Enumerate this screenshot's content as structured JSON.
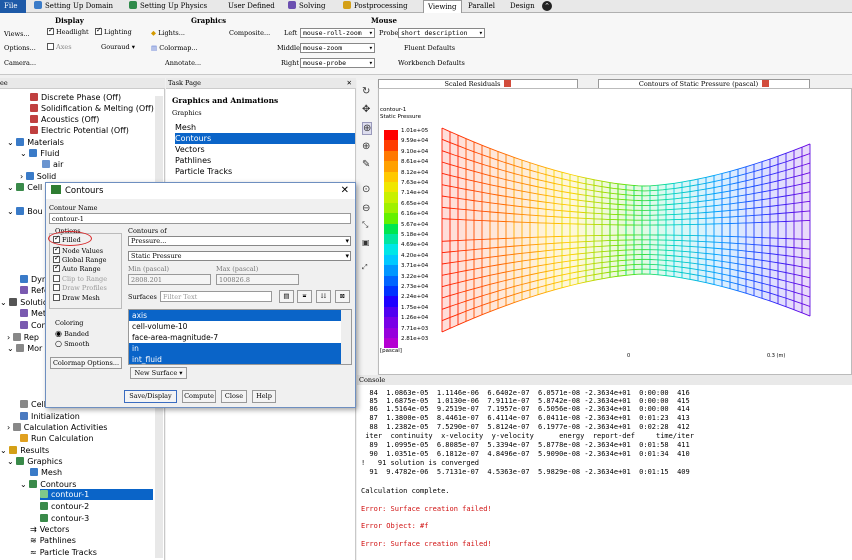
{
  "tabs": [
    "File",
    "Setting Up Domain",
    "Setting Up Physics",
    "User Defined",
    "Solving",
    "Postprocessing",
    "Viewing",
    "Parallel",
    "Design"
  ],
  "ribbon": {
    "display": {
      "heading": "Display",
      "views": "Views...",
      "options": "Options...",
      "camera": "Camera...",
      "headlight": "Headlight",
      "lighting": "Lighting",
      "axes": "Axes",
      "shading": "Gouraud"
    },
    "graphics": {
      "heading": "Graphics",
      "lights": "Lights...",
      "composite": "Composite...",
      "colormap": "Colormap...",
      "annotate": "Annotate..."
    },
    "mouse": {
      "heading": "Mouse",
      "left_label": "Left",
      "left_value": "mouse-roll-zoom",
      "middle_label": "Middle",
      "middle_value": "mouse-zoom",
      "right_label": "Right",
      "right_value": "mouse-probe",
      "probe_label": "Probe",
      "probe_value": "short description",
      "fluent_defaults": "Fluent Defaults",
      "workbench_defaults": "Workbench Defaults"
    }
  },
  "tree": {
    "header": "ee",
    "items": [
      "Discrete Phase (Off)",
      "Solidification & Melting (Off)",
      "Acoustics (Off)",
      "Electric Potential (Off)",
      "Materials",
      "Fluid",
      "air",
      "Solid",
      "Cell",
      "Bou",
      "Dyn",
      "Refe",
      "Solutio",
      "Met",
      "Con",
      "Rep",
      "Mor",
      "Cell",
      "Initialization",
      "Calculation Activities",
      "Run Calculation",
      "Results",
      "Graphics",
      "Mesh",
      "Contours",
      "contour-1",
      "contour-2",
      "contour-3",
      "Vectors",
      "Pathlines",
      "Particle Tracks"
    ]
  },
  "task_page": {
    "header": "Task Page",
    "title": "Graphics and Animations",
    "subtitle": "Graphics",
    "list": [
      "Mesh",
      "Contours",
      "Vectors",
      "Pathlines",
      "Particle Tracks"
    ]
  },
  "graphics_tabs": [
    "Scaled Residuals",
    "Contours of Static Pressure (pascal)"
  ],
  "contour_plot": {
    "name": "contour-1",
    "quantity": "Static Pressure",
    "unit": "[pascal]",
    "levels": [
      "1.01e+05",
      "9.59e+04",
      "9.10e+04",
      "8.61e+04",
      "8.12e+04",
      "7.63e+04",
      "7.14e+04",
      "6.65e+04",
      "6.16e+04",
      "5.67e+04",
      "5.18e+04",
      "4.69e+04",
      "4.20e+04",
      "3.71e+04",
      "3.22e+04",
      "2.73e+04",
      "2.24e+04",
      "1.75e+04",
      "1.26e+04",
      "7.71e+03",
      "2.81e+03"
    ],
    "level_colors": [
      "#ff0000",
      "#ff3c00",
      "#ff7800",
      "#ffa000",
      "#ffc800",
      "#f0e600",
      "#c8f000",
      "#a0f000",
      "#64f000",
      "#00e650",
      "#00e6a0",
      "#00e6e6",
      "#00c8ff",
      "#0096ff",
      "#0064ff",
      "#0032ff",
      "#1e00ff",
      "#5000f0",
      "#7800e6",
      "#9600dc",
      "#b400d2"
    ],
    "scale_label": "0.3 (m)",
    "scale_zero": "0"
  },
  "console": {
    "header": "Console",
    "rows": [
      "  84  1.0863e-05  1.1146e-06  6.6402e-07  6.0571e-08 -2.3634e+01  0:00:00  416",
      "  85  1.6875e-05  1.0130e-06  7.9111e-07  5.8742e-08 -2.3634e+01  0:00:00  415",
      "  86  1.5164e-05  9.2519e-07  7.1957e-07  6.5056e-08 -2.3634e+01  0:00:00  414",
      "  87  1.3800e-05  8.4461e-07  6.4114e-07  6.0411e-08 -2.3634e+01  0:01:23  413",
      "  88  1.2382e-05  7.5290e-07  5.8124e-07  6.1977e-08 -2.3634e+01  0:02:28  412",
      " iter  continuity  x-velocity  y-velocity      energy  report-def     time/iter",
      "  89  1.0995e-05  6.8085e-07  5.3394e-07  5.8778e-08 -2.3634e+01  0:01:58  411",
      "  90  1.0351e-05  6.1812e-07  4.8496e-07  5.9090e-08 -2.3634e+01  0:01:34  410",
      "!   91 solution is converged",
      "  91  9.4782e-06  5.7131e-07  4.5363e-07  5.9829e-08 -2.3634e+01  0:01:15  409"
    ],
    "complete": "Calculation complete.",
    "error1": "Error: Surface creation failed!",
    "error_object": "Error Object: #f",
    "error2": "Error: Surface creation failed!"
  },
  "dialog": {
    "title": "Contours",
    "contour_name_label": "Contour Name",
    "contour_name": "contour-1",
    "options_label": "Options",
    "filled": "Filled",
    "node_values": "Node Values",
    "global_range": "Global Range",
    "auto_range": "Auto Range",
    "clip_to_range": "Clip to Range",
    "draw_profiles": "Draw Profiles",
    "draw_mesh": "Draw Mesh",
    "contours_of_label": "Contours of",
    "contours_of": "Pressure...",
    "quantity": "Static Pressure",
    "min_label": "Min (pascal)",
    "min_value": "2808.201",
    "max_label": "Max (pascal)",
    "max_value": "100826.8",
    "surfaces_label": "Surfaces",
    "filter_placeholder": "Filter Text",
    "surfaces": [
      "axis",
      "cell-volume-10",
      "face-area-magnitude-7",
      "in",
      "int_fluid"
    ],
    "coloring_label": "Coloring",
    "banded": "Banded",
    "smooth": "Smooth",
    "colormap_options": "Colormap Options...",
    "new_surface": "New Surface",
    "save_display": "Save/Display",
    "compute": "Compute",
    "close": "Close",
    "help": "Help"
  }
}
